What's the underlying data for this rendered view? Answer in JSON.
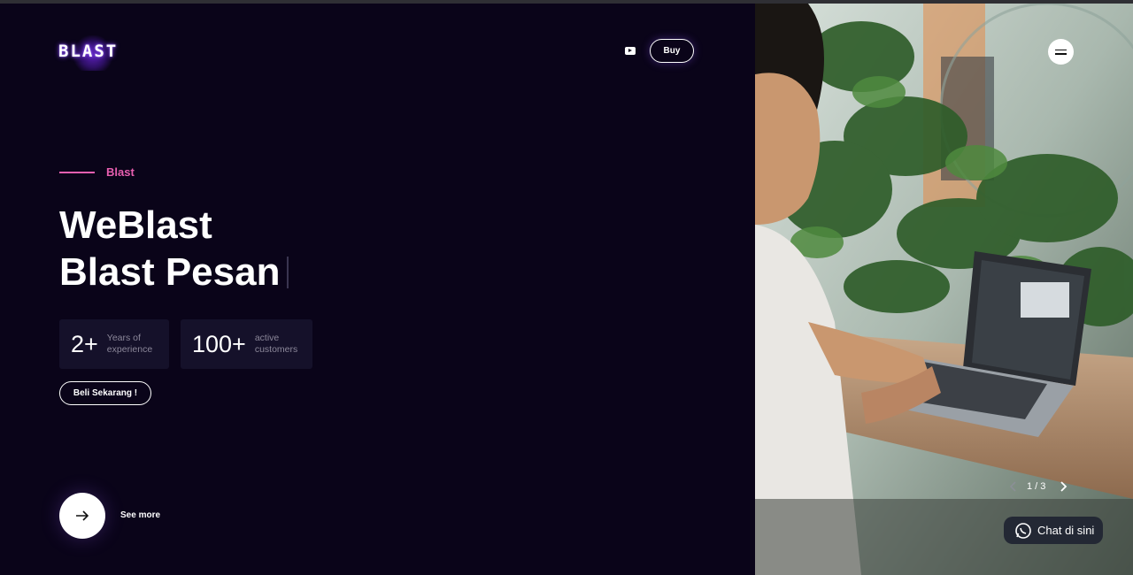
{
  "brand": {
    "logo_text": "BLAST"
  },
  "header": {
    "buy_label": "Buy",
    "social_icon": "youtube-icon"
  },
  "hero": {
    "eyebrow": "Blast",
    "title_line1": "WeBlast",
    "title_line2": "Blast Pesan",
    "stats": [
      {
        "number": "2+",
        "label": "Years of\nexperience"
      },
      {
        "number": "100+",
        "label": "active\ncustomers"
      }
    ],
    "cta_label": "Beli Sekarang !",
    "see_more_label": "See more"
  },
  "slider": {
    "counter": "1 / 3"
  },
  "chat": {
    "label": "Chat di sini"
  },
  "colors": {
    "background": "#0a0419",
    "accent": "#e85fb0",
    "stat_card": "#15112a",
    "chat_bg": "#232834"
  }
}
